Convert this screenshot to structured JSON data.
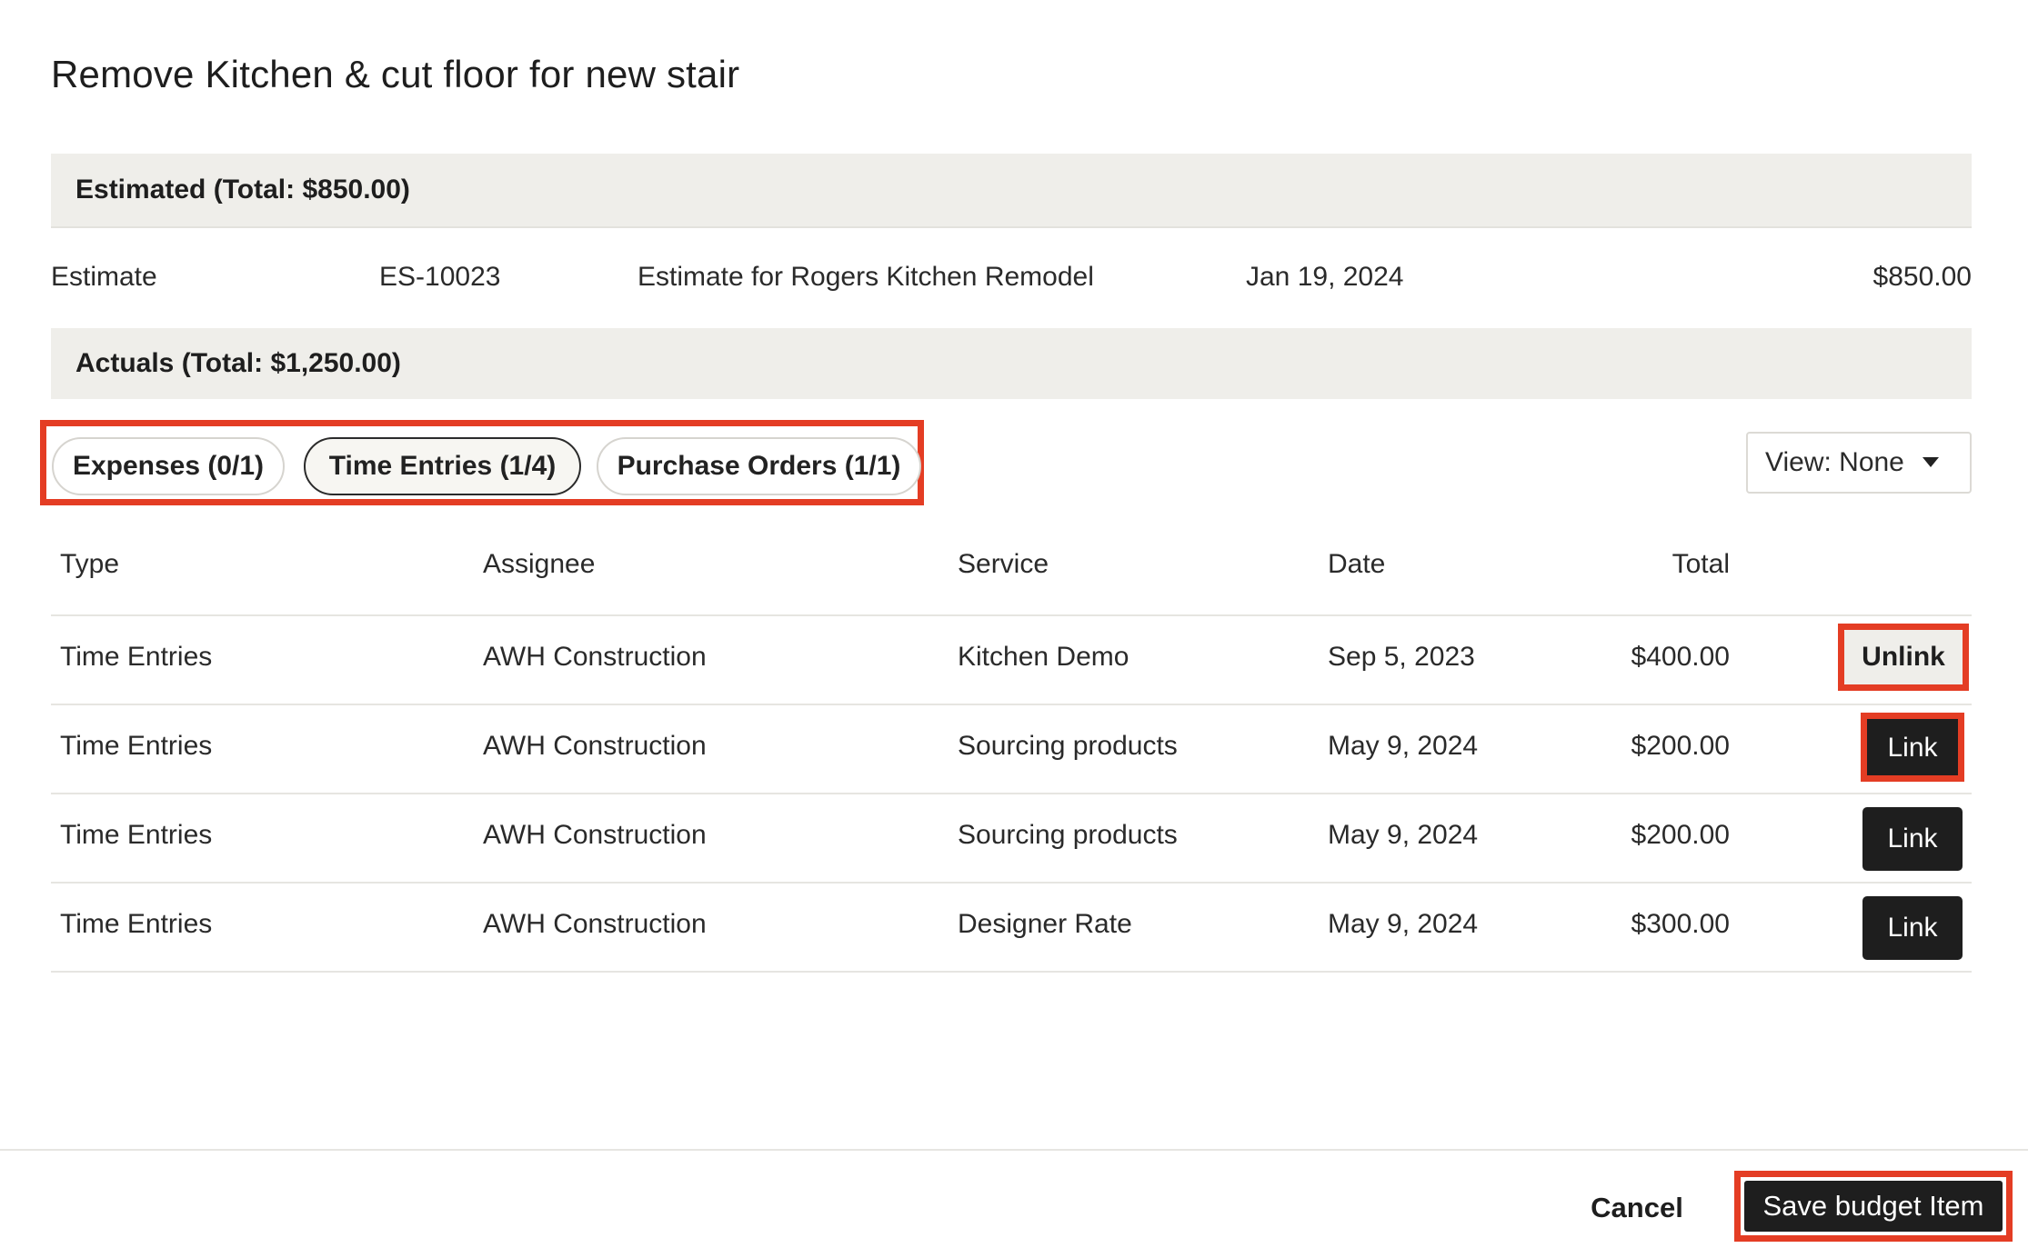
{
  "modal": {
    "title": "Remove Kitchen & cut floor for new stair"
  },
  "estimated": {
    "header": "Estimated (Total: $850.00)",
    "row": {
      "type": "Estimate",
      "number": "ES-10023",
      "description": "Estimate for Rogers Kitchen Remodel",
      "date": "Jan 19, 2024",
      "amount": "$850.00"
    }
  },
  "actuals": {
    "header": "Actuals (Total: $1,250.00)",
    "tabs": [
      {
        "label": "Expenses (0/1)",
        "active": false
      },
      {
        "label": "Time Entries (1/4)",
        "active": true
      },
      {
        "label": "Purchase Orders (1/1)",
        "active": false
      }
    ],
    "view_select": {
      "label": "View: None"
    },
    "table": {
      "columns": [
        "Type",
        "Assignee",
        "Service",
        "Date",
        "Total"
      ],
      "rows": [
        {
          "type": "Time Entries",
          "assignee": "AWH Construction",
          "service": "Kitchen Demo",
          "date": "Sep 5, 2023",
          "total": "$400.00",
          "action": "Unlink"
        },
        {
          "type": "Time Entries",
          "assignee": "AWH Construction",
          "service": "Sourcing products",
          "date": "May 9, 2024",
          "total": "$200.00",
          "action": "Link"
        },
        {
          "type": "Time Entries",
          "assignee": "AWH Construction",
          "service": "Sourcing products",
          "date": "May 9, 2024",
          "total": "$200.00",
          "action": "Link"
        },
        {
          "type": "Time Entries",
          "assignee": "AWH Construction",
          "service": "Designer Rate",
          "date": "May 9, 2024",
          "total": "$300.00",
          "action": "Link"
        }
      ]
    }
  },
  "footer": {
    "cancel_label": "Cancel",
    "save_label": "Save budget Item"
  },
  "colors": {
    "highlight": "#e43d24",
    "section_bg": "#efeeea",
    "button_dark": "#1e1e1e"
  }
}
